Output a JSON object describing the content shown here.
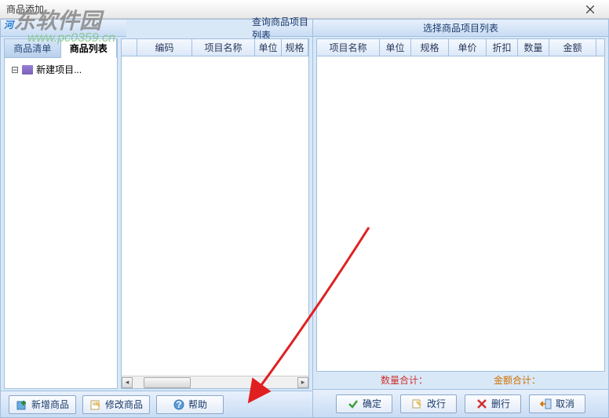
{
  "window": {
    "title": "商品添加"
  },
  "watermark": {
    "brand": "河东软件园",
    "url": "www.pc0359.cn"
  },
  "left": {
    "header": "查询商品项目列表",
    "tabs": {
      "list": "商品清单",
      "items": "商品列表"
    },
    "tree": {
      "root": "新建项目..."
    },
    "grid": {
      "cols": [
        "",
        "编码",
        "项目名称",
        "单位",
        "规格"
      ]
    },
    "buttons": {
      "add": "新增商品",
      "edit": "修改商品",
      "help": "帮助"
    }
  },
  "right": {
    "header": "选择商品项目列表",
    "grid": {
      "cols": [
        "项目名称",
        "单位",
        "规格",
        "单价",
        "折扣",
        "数量",
        "金额"
      ]
    },
    "summary": {
      "qty": "数量合计：",
      "amount": "金额合计："
    },
    "buttons": {
      "ok": "确定",
      "modify": "改行",
      "delete": "删行",
      "cancel": "取消"
    }
  }
}
